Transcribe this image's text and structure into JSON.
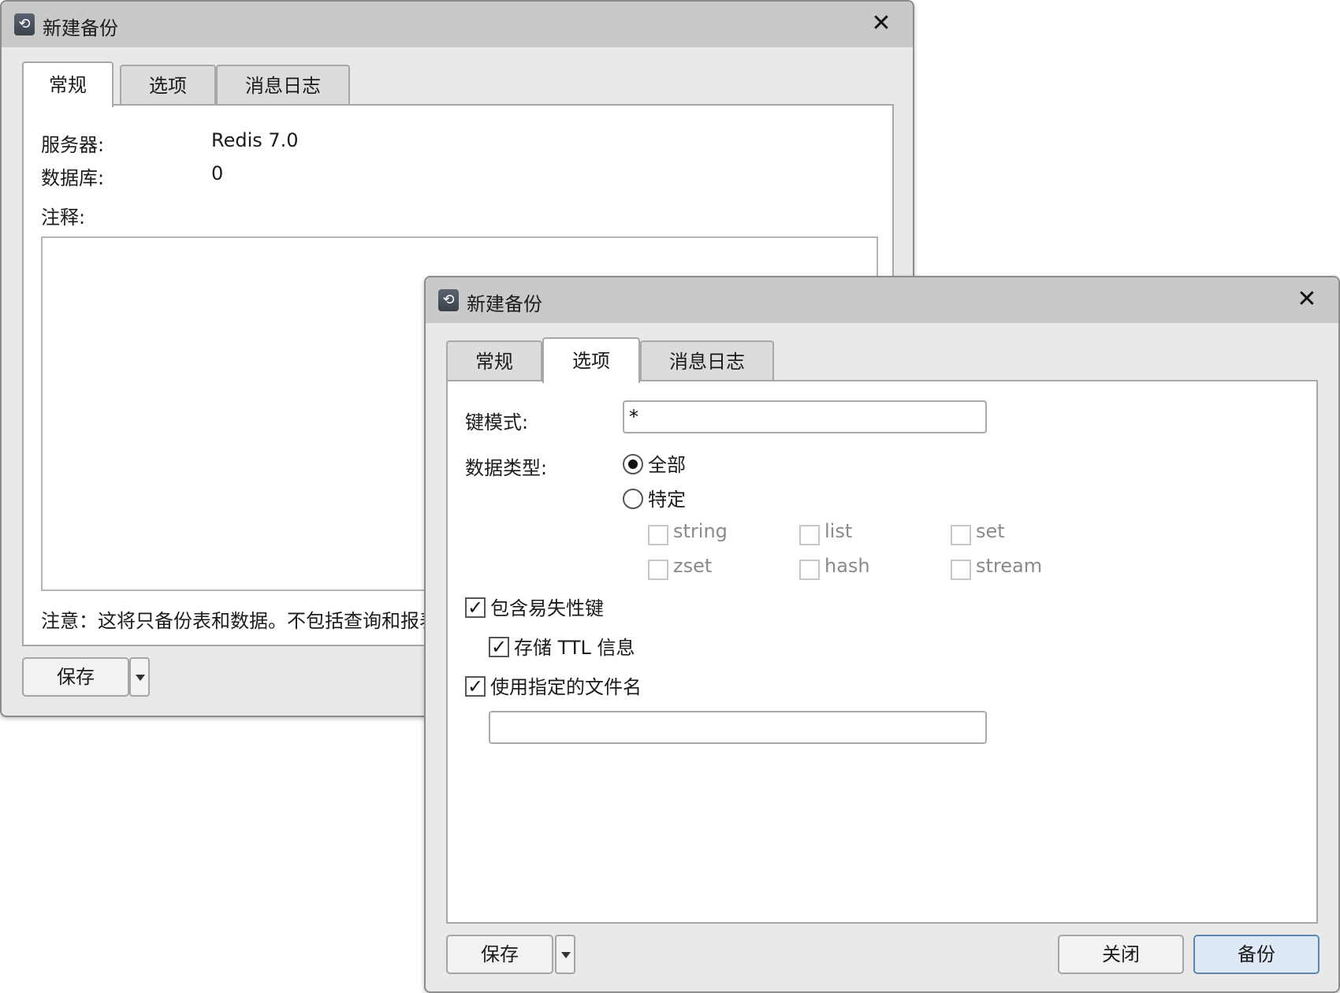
{
  "win1": {
    "title": "新建备份",
    "tabs": [
      "常规",
      "选项",
      "消息日志"
    ],
    "server_label": "服务器:",
    "server_value": "Redis 7.0",
    "database_label": "数据库:",
    "database_value": "0",
    "comment_label": "注释:",
    "note": "注意：这将只备份表和数据。不包括查询和报表",
    "save_label": "保存"
  },
  "win2": {
    "title": "新建备份",
    "tabs": [
      "常规",
      "选项",
      "消息日志"
    ],
    "key_pattern_label": "键模式:",
    "key_pattern_value": "*",
    "data_type_label": "数据类型:",
    "radio_all": "全部",
    "radio_specific": "特定",
    "types": [
      "string",
      "list",
      "set",
      "zset",
      "hash",
      "stream"
    ],
    "include_volatile": "包含易失性键",
    "store_ttl": "存储 TTL 信息",
    "use_filename": "使用指定的文件名",
    "filename_value": "",
    "save_label": "保存",
    "close_label": "关闭",
    "backup_label": "备份"
  },
  "icons": {
    "app": "backup-restore-icon",
    "close": "close-icon",
    "check": "✓"
  }
}
